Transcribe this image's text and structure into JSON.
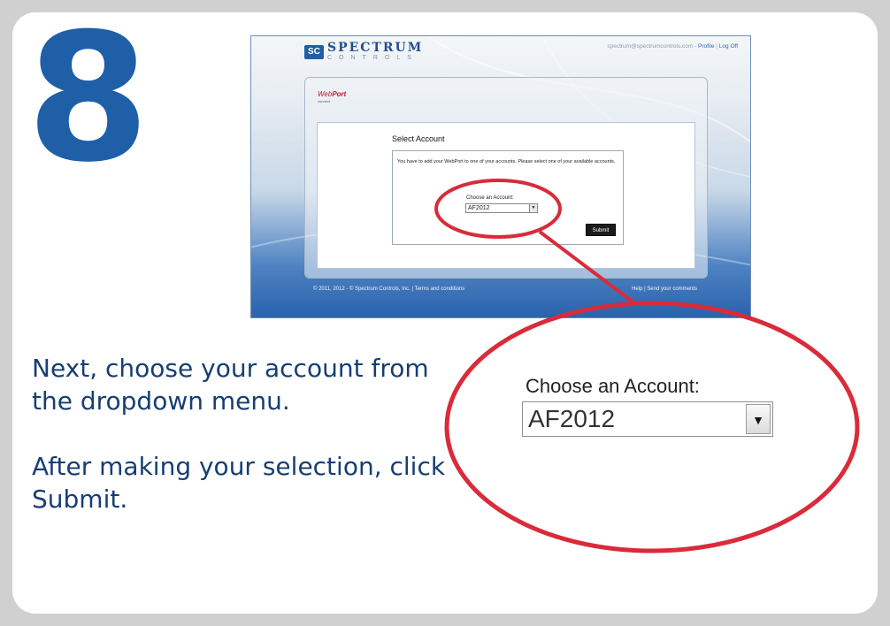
{
  "step": {
    "number": "8"
  },
  "screenshot": {
    "brand_name": "SPECTRUM",
    "brand_sub": "CONTROLS",
    "brand_logo_text": "SC",
    "top_links": {
      "email": "spectrum@spectrumcontrols.com",
      "separator1": " - ",
      "profile": "Profile",
      "separator2": " | ",
      "logoff": "Log Off"
    },
    "webport_logo": {
      "web": "Web",
      "port": "Port",
      "sub": "connect"
    },
    "panel_title": "Select Account",
    "message": "You have to add your WebPort to one of your accounts. Please select one of your available accounts.",
    "choose_label": "Choose an Account:",
    "selected_account": "AF2012",
    "submit_label": "Submit",
    "footer_left": "© 2011, 2012 - © Spectrum Controls, Inc. | Terms and conditions",
    "footer_right": "Help | Send your comments"
  },
  "zoom": {
    "choose_label": "Choose an Account:",
    "selected_account": "AF2012",
    "arrow_icon": "chevron-down-icon"
  },
  "instructions": {
    "para1": "Next, choose your account from the dropdown menu.",
    "para2": "After making your selection, click Submit."
  },
  "colors": {
    "accent_blue": "#1f5fa8",
    "text_navy": "#173e73",
    "highlight_red": "#d92b3a",
    "frame_gray": "#d0d0d0"
  }
}
